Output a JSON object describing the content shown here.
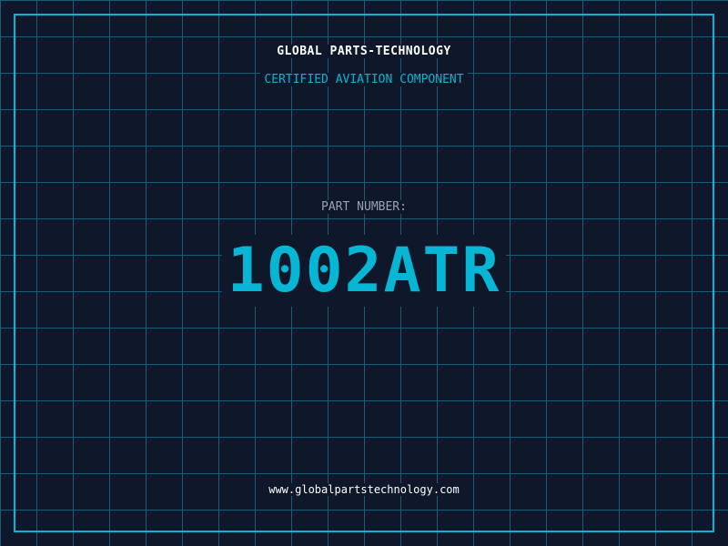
{
  "header": {
    "company": "GLOBAL PARTS-TECHNOLOGY",
    "subtitle": "CERTIFIED AVIATION COMPONENT"
  },
  "main": {
    "label": "PART NUMBER:",
    "part_number": "1002ATR"
  },
  "footer": {
    "url": "www.globalpartstechnology.com"
  },
  "colors": {
    "background": "#0f172a",
    "accent": "#06b6d4",
    "grid": "#155e75"
  }
}
